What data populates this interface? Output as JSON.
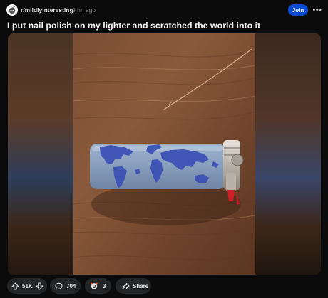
{
  "header": {
    "subreddit": "r/mildlyinteresting",
    "separator": "•",
    "time": "9 hr. ago",
    "join_label": "Join",
    "more_label": "•••",
    "avatar_icon": "subreddit-avatar-icon"
  },
  "post": {
    "title": "I put nail polish on my lighter and scratched the world into it"
  },
  "footer": {
    "upvotes": "51K",
    "comments": "704",
    "awards": "3",
    "share_label": "Share"
  },
  "colors": {
    "accent": "#0a4ad1",
    "pill_bg": "#232426",
    "background": "#0b0b0b"
  }
}
